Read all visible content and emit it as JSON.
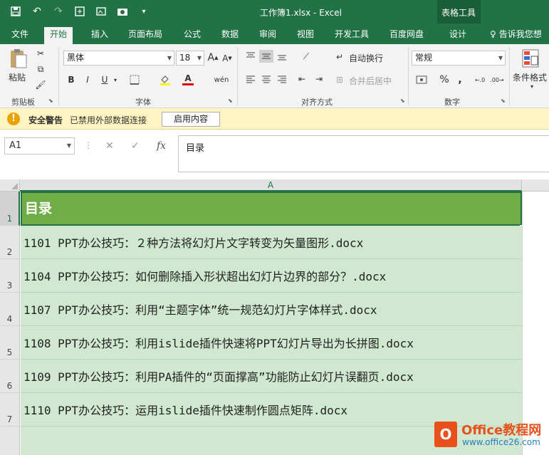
{
  "title": "工作簿1.xlsx - Excel",
  "context_tab_group": "表格工具",
  "tabs": [
    {
      "label": "文件"
    },
    {
      "label": "开始"
    },
    {
      "label": "插入"
    },
    {
      "label": "页面布局"
    },
    {
      "label": "公式"
    },
    {
      "label": "数据"
    },
    {
      "label": "审阅"
    },
    {
      "label": "视图"
    },
    {
      "label": "开发工具"
    },
    {
      "label": "百度网盘"
    },
    {
      "label": "设计"
    }
  ],
  "tell_me": "告诉我您想",
  "ribbon": {
    "clipboard": {
      "label": "剪贴板",
      "paste": "粘贴"
    },
    "font": {
      "label": "字体",
      "name": "黑体",
      "size": "18",
      "bold": "B",
      "italic": "I",
      "underline": "U",
      "grow": "A",
      "shrink": "A",
      "font_color": "A",
      "phonetic": "wén"
    },
    "alignment": {
      "label": "对齐方式",
      "wrap": "自动换行",
      "merge": "合并后居中"
    },
    "number": {
      "label": "数字",
      "format": "常规",
      "percent": "%",
      "comma": ","
    },
    "styles": {
      "conditional": "条件格式"
    }
  },
  "security": {
    "title": "安全警告",
    "message": "已禁用外部数据连接",
    "button": "启用内容"
  },
  "formula_bar": {
    "name_box": "A1",
    "cancel": "✕",
    "enter": "✓",
    "fx": "fx",
    "content": "目录"
  },
  "sheet": {
    "column": "A",
    "rows": [
      {
        "num": "1",
        "text": "目录"
      },
      {
        "num": "2",
        "text": "1101  PPT办公技巧：２种方法将幻灯片文字转变为矢量图形.docx"
      },
      {
        "num": "3",
        "text": "1104  PPT办公技巧：如何删除插入形状超出幻灯片边界的部分？.docx"
      },
      {
        "num": "4",
        "text": "1107  PPT办公技巧：利用“主题字体”统一规范幻灯片字体样式.docx"
      },
      {
        "num": "5",
        "text": "1108  PPT办公技巧：利用islide插件快速将PPT幻灯片导出为长拼图.docx"
      },
      {
        "num": "6",
        "text": "1109  PPT办公技巧：利用PA插件的“页面撑高”功能防止幻灯片误翻页.docx"
      },
      {
        "num": "7",
        "text": "1110  PPT办公技巧：运用islide插件快速制作圆点矩阵.docx"
      }
    ]
  },
  "watermark": {
    "title": "Office教程网",
    "url": "www.office26.com"
  },
  "colors": {
    "brand": "#217346",
    "header_fill": "#70ad47",
    "row_fill": "#cfe8cf"
  }
}
